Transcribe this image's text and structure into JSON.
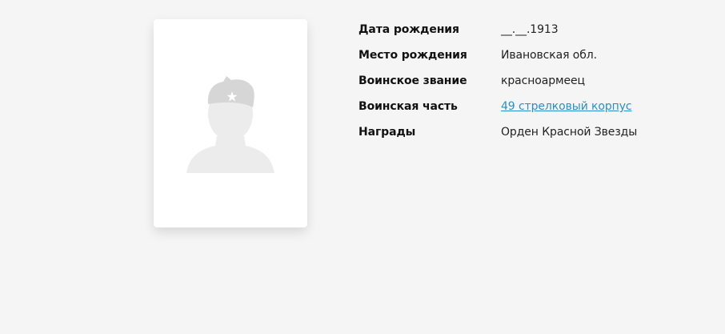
{
  "person": {
    "photo_icon": "soldier-silhouette-icon",
    "fields": [
      {
        "label": "Дата рождения",
        "value": "__.__.1913"
      },
      {
        "label": "Место рождения",
        "value": "Ивановская обл."
      },
      {
        "label": "Воинское звание",
        "value": "красноармеец"
      },
      {
        "label": "Воинская часть",
        "value": "49 стрелковый корпус"
      },
      {
        "label": "Награды",
        "value": "Орден Красной Звезды"
      }
    ]
  },
  "colors": {
    "background": "#f5f5f5",
    "card": "#ffffff",
    "link": "#2a8fc9",
    "silhouette": "#ececec",
    "cap": "#d6d6d6"
  }
}
